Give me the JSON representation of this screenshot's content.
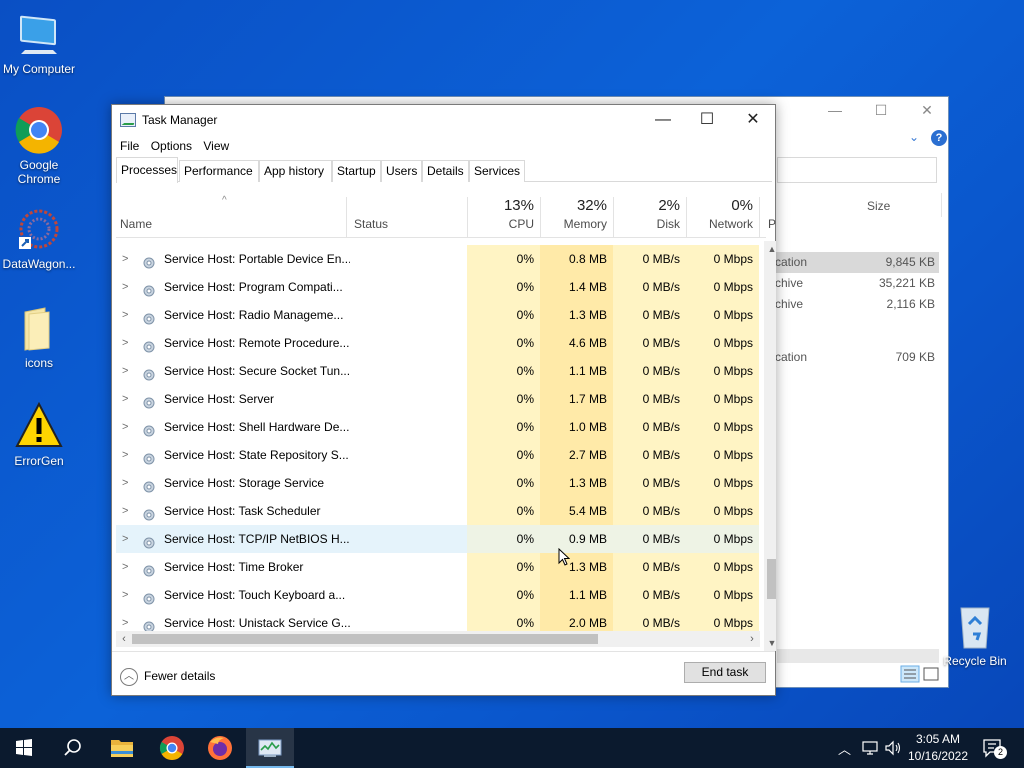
{
  "desktop": {
    "icons": [
      {
        "label": "My Computer",
        "icon": "monitor-icon"
      },
      {
        "label": "Google Chrome",
        "icon": "chrome-icon"
      },
      {
        "label": "DataWagon...",
        "icon": "datawagon-icon"
      },
      {
        "label": "icons",
        "icon": "folder-icon"
      },
      {
        "label": "ErrorGen",
        "icon": "warning-icon"
      },
      {
        "label": "Recycle Bin",
        "icon": "recycle-bin-icon"
      }
    ]
  },
  "explorer": {
    "size_header": "Size",
    "rows": [
      {
        "type": "cation",
        "size": "9,845 KB"
      },
      {
        "type": "chive",
        "size": "35,221 KB"
      },
      {
        "type": "chive",
        "size": "2,116 KB"
      },
      {
        "type": "cation",
        "size": "709 KB"
      }
    ]
  },
  "task_manager": {
    "title": "Task Manager",
    "menu": [
      "File",
      "Options",
      "View"
    ],
    "tabs": [
      "Processes",
      "Performance",
      "App history",
      "Startup",
      "Users",
      "Details",
      "Services"
    ],
    "columns": {
      "name": "Name",
      "status": "Status",
      "cpu": {
        "pct": "13%",
        "label": "CPU"
      },
      "memory": {
        "pct": "32%",
        "label": "Memory"
      },
      "disk": {
        "pct": "2%",
        "label": "Disk"
      },
      "network": {
        "pct": "0%",
        "label": "Network"
      },
      "power": "P"
    },
    "rows": [
      {
        "name": "Service Host: Portable Device En...",
        "cpu": "0%",
        "mem": "0.8 MB",
        "disk": "0 MB/s",
        "net": "0 Mbps"
      },
      {
        "name": "Service Host: Program Compati...",
        "cpu": "0%",
        "mem": "1.4 MB",
        "disk": "0 MB/s",
        "net": "0 Mbps"
      },
      {
        "name": "Service Host: Radio Manageme...",
        "cpu": "0%",
        "mem": "1.3 MB",
        "disk": "0 MB/s",
        "net": "0 Mbps"
      },
      {
        "name": "Service Host: Remote Procedure...",
        "cpu": "0%",
        "mem": "4.6 MB",
        "disk": "0 MB/s",
        "net": "0 Mbps"
      },
      {
        "name": "Service Host: Secure Socket Tun...",
        "cpu": "0%",
        "mem": "1.1 MB",
        "disk": "0 MB/s",
        "net": "0 Mbps"
      },
      {
        "name": "Service Host: Server",
        "cpu": "0%",
        "mem": "1.7 MB",
        "disk": "0 MB/s",
        "net": "0 Mbps"
      },
      {
        "name": "Service Host: Shell Hardware De...",
        "cpu": "0%",
        "mem": "1.0 MB",
        "disk": "0 MB/s",
        "net": "0 Mbps"
      },
      {
        "name": "Service Host: State Repository S...",
        "cpu": "0%",
        "mem": "2.7 MB",
        "disk": "0 MB/s",
        "net": "0 Mbps"
      },
      {
        "name": "Service Host: Storage Service",
        "cpu": "0%",
        "mem": "1.3 MB",
        "disk": "0 MB/s",
        "net": "0 Mbps"
      },
      {
        "name": "Service Host: Task Scheduler",
        "cpu": "0%",
        "mem": "5.4 MB",
        "disk": "0 MB/s",
        "net": "0 Mbps"
      },
      {
        "name": "Service Host: TCP/IP NetBIOS H...",
        "cpu": "0%",
        "mem": "0.9 MB",
        "disk": "0 MB/s",
        "net": "0 Mbps"
      },
      {
        "name": "Service Host: Time Broker",
        "cpu": "0%",
        "mem": "1.3 MB",
        "disk": "0 MB/s",
        "net": "0 Mbps"
      },
      {
        "name": "Service Host: Touch Keyboard a...",
        "cpu": "0%",
        "mem": "1.1 MB",
        "disk": "0 MB/s",
        "net": "0 Mbps"
      },
      {
        "name": "Service Host: Unistack Service G...",
        "cpu": "0%",
        "mem": "2.0 MB",
        "disk": "0 MB/s",
        "net": "0 Mbps"
      }
    ],
    "highlighted_row": "Service Host: TCP/IP NetBIOS H...",
    "fewer_details": "Fewer details",
    "end_task": "End task"
  },
  "taskbar": {
    "apps": [
      "start-icon",
      "search-icon",
      "file-explorer-icon",
      "chrome-icon",
      "firefox-icon",
      "task-manager-icon"
    ],
    "time": "3:05 AM",
    "date": "10/16/2022",
    "notification_count": "2"
  },
  "colors": {
    "desktop_blue": "#0c62d8",
    "cpu_heat": "#fff4c4",
    "memory_heat": "#ffeaa8",
    "taskbar": "#0b1a2e"
  }
}
